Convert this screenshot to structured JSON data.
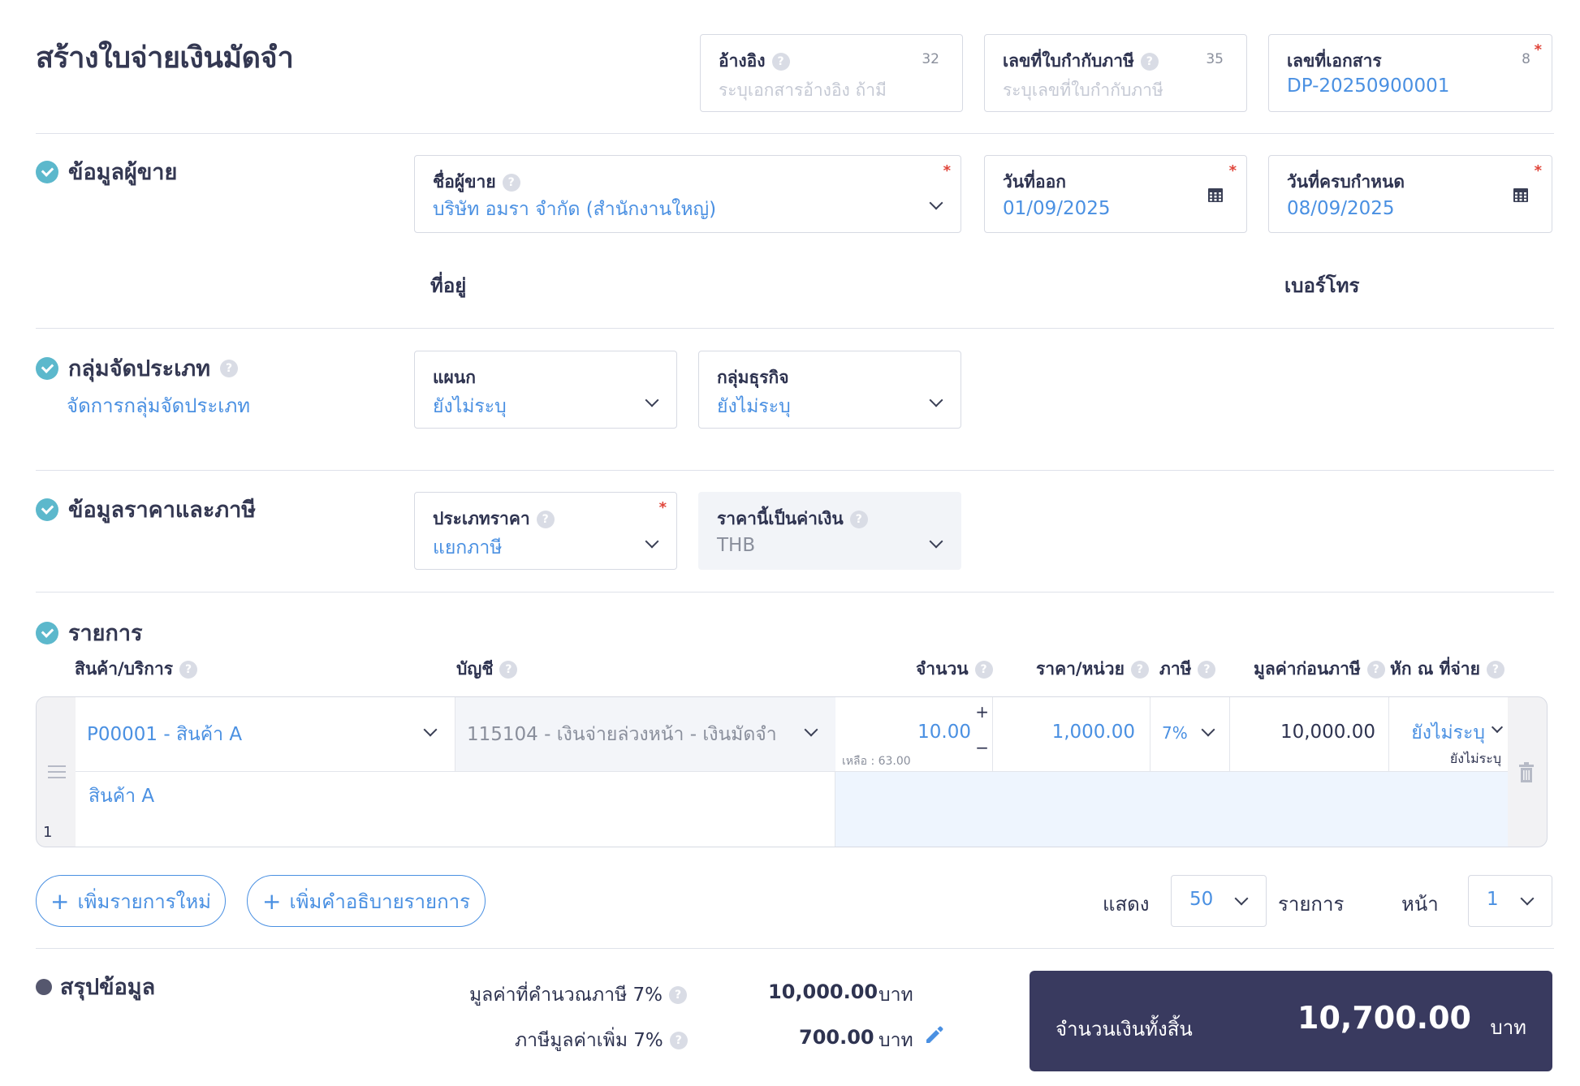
{
  "page": {
    "title": "สร้างใบจ่ายเงินมัดจำ"
  },
  "header_fields": {
    "reference": {
      "label": "อ้างอิง",
      "placeholder": "ระบุเอกสารอ้างอิง ถ้ามี",
      "counter": "32"
    },
    "tax_invoice_no": {
      "label": "เลขที่ใบกำกับภาษี",
      "placeholder": "ระบุเลขที่ใบกำกับภาษี",
      "counter": "35"
    },
    "document_no": {
      "label": "เลขที่เอกสาร",
      "value": "DP-20250900001",
      "counter": "8"
    }
  },
  "seller": {
    "section_title": "ข้อมูลผู้ขาย",
    "name_label": "ชื่อผู้ขาย",
    "name_value": "บริษัท อมรา จำกัด (สำนักงานใหญ่)",
    "issue_date_label": "วันที่ออก",
    "issue_date_value": "01/09/2025",
    "due_date_label": "วันที่ครบกำหนด",
    "due_date_value": "08/09/2025",
    "address_label": "ที่อยู่",
    "phone_label": "เบอร์โทร"
  },
  "classification": {
    "section_title": "กลุ่มจัดประเภท",
    "manage_link": "จัดการกลุ่มจัดประเภท",
    "department_label": "แผนก",
    "department_value": "ยังไม่ระบุ",
    "business_group_label": "กลุ่มธุรกิจ",
    "business_group_value": "ยังไม่ระบุ"
  },
  "pricing": {
    "section_title": "ข้อมูลราคาและภาษี",
    "price_type_label": "ประเภทราคา",
    "price_type_value": "แยกภาษี",
    "currency_label": "ราคานี้เป็นค่าเงิน",
    "currency_value": "THB"
  },
  "items": {
    "section_title": "รายการ",
    "columns": {
      "product": "สินค้า/บริการ",
      "account": "บัญชี",
      "qty": "จำนวน",
      "unit_price": "ราคา/หน่วย",
      "tax": "ภาษี",
      "pretax": "มูลค่าก่อนภาษี",
      "withholding": "หัก ณ ที่จ่าย"
    },
    "rows": [
      {
        "index": "1",
        "product": "P00001 - สินค้า A",
        "account": "115104 - เงินจ่ายล่วงหน้า - เงินมัดจำ",
        "qty": "10.00",
        "remaining": "เหลือ : 63.00",
        "unit_price": "1,000.00",
        "tax": "7%",
        "pretax": "10,000.00",
        "withholding": "ยังไม่ระบุ",
        "withholding_sub": "ยังไม่ระบุ",
        "description": "สินค้า A"
      }
    ],
    "add_item_label": "เพิ่มรายการใหม่",
    "add_desc_label": "เพิ่มคำอธิบายรายการ",
    "show_label": "แสดง",
    "per_page_value": "50",
    "items_label": "รายการ",
    "page_label": "หน้า",
    "page_value": "1"
  },
  "summary": {
    "section_title": "สรุปข้อมูล",
    "taxable_label": "มูลค่าที่คำนวณภาษี 7%",
    "taxable_value": "10,000.00",
    "vat_label": "ภาษีมูลค่าเพิ่ม 7%",
    "vat_value": "700.00",
    "currency_unit": "บาท",
    "total_label": "จำนวนเงินทั้งสิ้น",
    "total_value": "10,700.00"
  },
  "colors": {
    "accent": "#4a90e2",
    "check": "#5cb8cc",
    "dark_panel": "#393a5f",
    "required": "#e0453a"
  }
}
